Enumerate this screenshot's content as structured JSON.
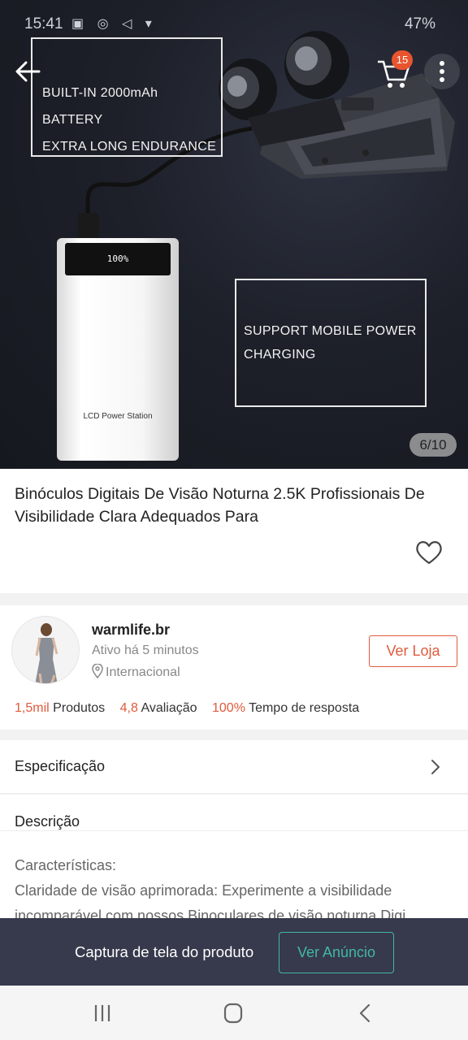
{
  "status_bar": {
    "time": "15:41",
    "icons": "▣ ◎ ◁ ▾",
    "battery": "47%"
  },
  "hero": {
    "box1_line1": "BUILT-IN 2000mAh BATTERY",
    "box1_line2": "EXTRA LONG ENDURANCE",
    "box2_line1": "SUPPORT MOBILE POWER",
    "box2_line2": "CHARGING",
    "powerbank_screen": "100%",
    "powerbank_label": "LCD Power Station",
    "image_counter": "6/10"
  },
  "header": {
    "cart_count": "15"
  },
  "product": {
    "title": "Binóculos Digitais De Visão Noturna 2.5K Profissionais De Visibilidade Clara Adequados Para"
  },
  "store": {
    "name": "warmlife.br",
    "active": "Ativo há 5 minutos",
    "location": "Internacional",
    "visit_label": "Ver Loja",
    "products_count": "1,5mil",
    "products_label": "Produtos",
    "rating": "4,8",
    "rating_label": "Avaliação",
    "response_rate": "100%",
    "response_label": "Tempo de resposta"
  },
  "specification": {
    "label": "Especificação"
  },
  "description": {
    "heading": "Descrição",
    "line1": "Características:",
    "line2": "Claridade de visão aprimorada: Experimente a visibilidade",
    "line3": "incomparável com nossos Binoculares de visão noturna Digi..."
  },
  "capture_bar": {
    "text": "Captura de tela do produto",
    "button_label": "Ver Anúncio"
  },
  "colors": {
    "accent": "#e15a3c",
    "teal": "#41b7a6",
    "capture_bg": "#373a4c"
  }
}
